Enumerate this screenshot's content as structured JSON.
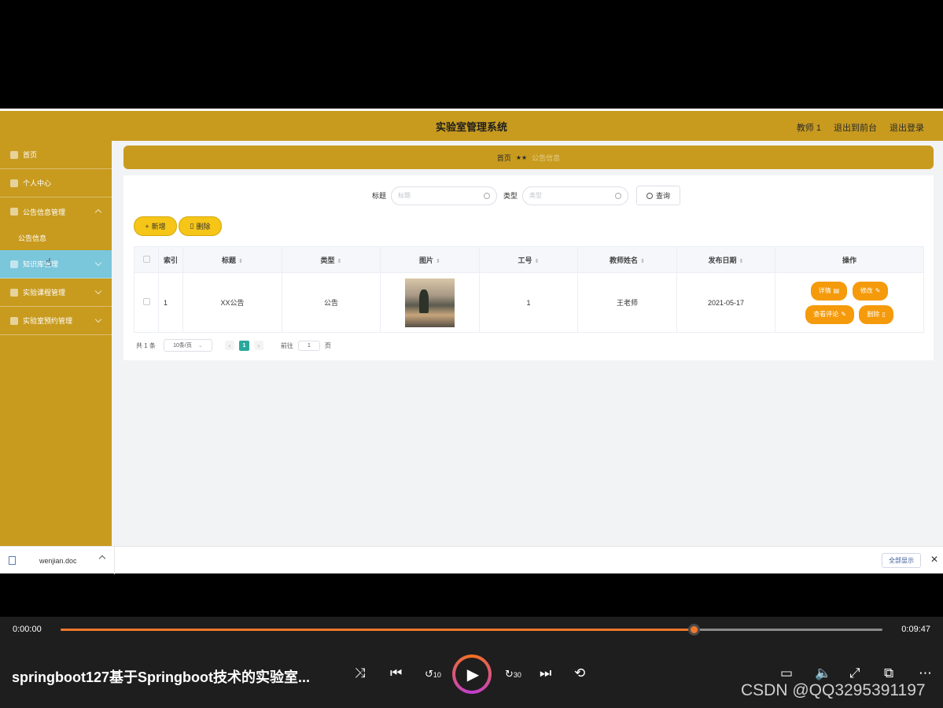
{
  "header": {
    "title": "实验室管理系统",
    "user": "教师 1",
    "to_front": "退出到前台",
    "logout": "退出登录"
  },
  "sidebar": {
    "items": [
      {
        "label": "首页"
      },
      {
        "label": "个人中心"
      },
      {
        "label": "公告信息管理"
      },
      {
        "label": "公告信息"
      },
      {
        "label": "知识库管理"
      },
      {
        "label": "实验课程管理"
      },
      {
        "label": "实验室预约管理"
      }
    ]
  },
  "breadcrumb": {
    "home": "首页",
    "sep": "★★",
    "current": "公告信息"
  },
  "search": {
    "title_label": "标题",
    "title_placeholder": "标题",
    "type_label": "类型",
    "type_placeholder": "类型",
    "query_label": "查询"
  },
  "actions": {
    "add_label": "新增",
    "delete_label": "删除"
  },
  "table": {
    "headers": [
      "索引",
      "标题",
      "类型",
      "图片",
      "工号",
      "教师姓名",
      "发布日期",
      "操作"
    ],
    "rows": [
      {
        "index": "1",
        "title": "XX公告",
        "type": "公告",
        "teacher_no": "1",
        "teacher_name": "王老师",
        "date": "2021-05-17"
      }
    ],
    "row_actions": {
      "detail": "详情",
      "edit": "修改",
      "comments": "查看评论",
      "delete": "删除"
    }
  },
  "pager": {
    "total": "共 1 条",
    "page_size": "10条/页",
    "current_page": "1",
    "goto_label": "前往",
    "goto_value": "1",
    "page_unit": "页"
  },
  "download_bar": {
    "file": "wenjian.doc",
    "show_all": "全部显示"
  },
  "player": {
    "time_current": "0:00:00",
    "time_total": "0:09:47",
    "progress": 0.77,
    "title": "springboot127基于Springboot技术的实验室...",
    "skip_back": "10",
    "skip_forward": "30",
    "accent": "#f0782c"
  },
  "watermark": "CSDN @QQ3295391197"
}
